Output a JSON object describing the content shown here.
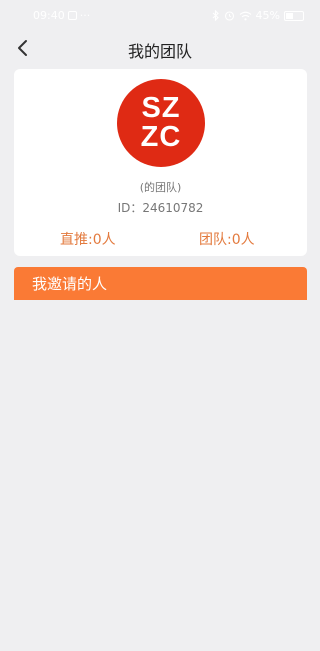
{
  "status_bar": {
    "time": "09:40",
    "dots": "···",
    "battery": "45%",
    "battery_level": 0.45
  },
  "nav": {
    "title": "我的团队"
  },
  "profile": {
    "avatar_line1": "SZ",
    "avatar_line2": "ZC",
    "avatar_color": "#df2a14",
    "team_name": "(的团队)",
    "id_label": "ID：",
    "id_value": "24610782",
    "direct_label": "直推:0人",
    "team_label": "团队:0人"
  },
  "invite": {
    "label": "我邀请的人",
    "color": "#fa7a35"
  },
  "icons": {
    "back": "chevron-left-icon"
  }
}
